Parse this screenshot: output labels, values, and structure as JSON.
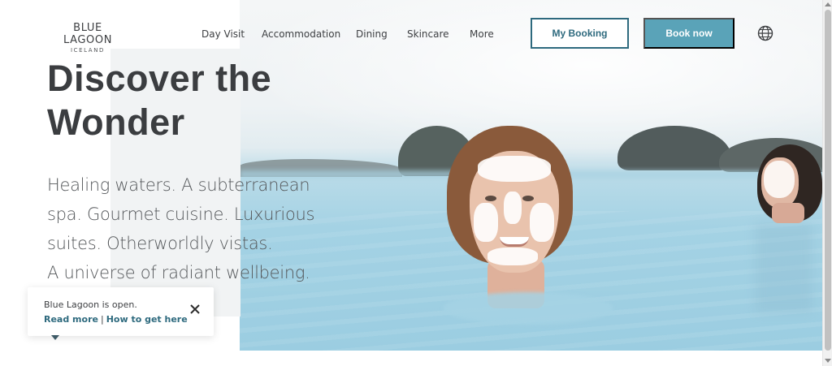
{
  "logo": {
    "main": "BLUE LAGOON",
    "sub": "ICELAND"
  },
  "nav": [
    {
      "label": "Day Visit"
    },
    {
      "label": "Accommodation"
    },
    {
      "label": "Dining"
    },
    {
      "label": "Skincare"
    },
    {
      "label": "More"
    }
  ],
  "header": {
    "my_booking_label": "My Booking",
    "book_now_label": "Book now",
    "language_icon": "globe-icon"
  },
  "hero": {
    "headline_line1": "Discover the",
    "headline_line2": "Wonder",
    "sub_lines": [
      "Healing waters. A subterranean",
      "spa. Gourmet cuisine. Luxurious",
      "suites. Otherworldly vistas.",
      "A universe of radiant wellbeing."
    ]
  },
  "notice": {
    "status_text": "Blue Lagoon is open.",
    "read_more_label": "Read more",
    "separator": "|",
    "directions_label": "How to get here",
    "close_icon": "close-icon"
  },
  "colors": {
    "accent": "#2e6a7e",
    "button_fill": "#5aa3b8",
    "text": "#3d3f42"
  }
}
